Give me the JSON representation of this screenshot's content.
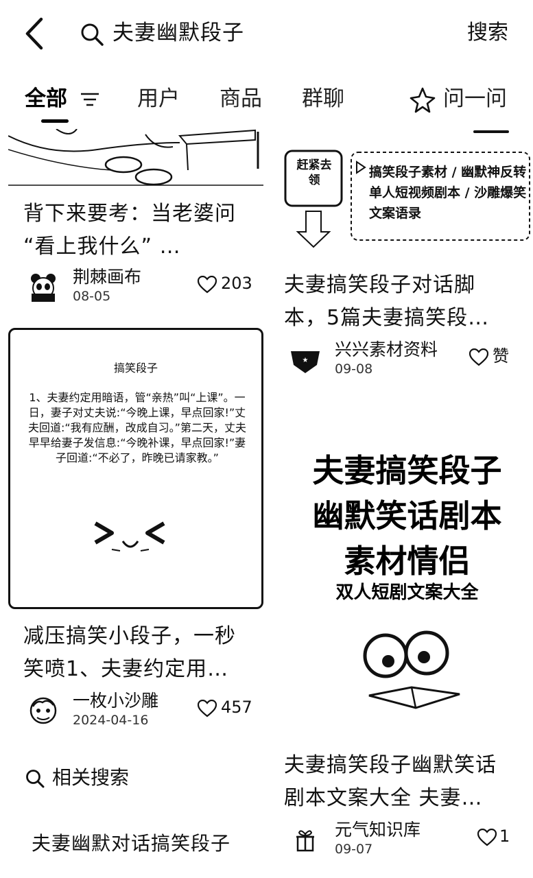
{
  "search": {
    "query": "夫妻幽默段子",
    "button_label": "搜索"
  },
  "tabs": [
    {
      "label": "全部"
    },
    {
      "label": "用户"
    },
    {
      "label": "商品"
    },
    {
      "label": "群聊"
    },
    {
      "label": "问一问"
    }
  ],
  "left_column": [
    {
      "title": "背下来要考：当老婆问 “看上我什么” …",
      "author": "荆棘画布",
      "date": "08-05",
      "likes": "203"
    },
    {
      "thumb": {
        "heading": "搞笑段子",
        "body": "1、夫妻约定用暗语，管“亲热”叫“上课”。一日，妻子对丈夫说:“今晚上课，早点回家!”丈夫回道:“我有应酬，改成自习。”第二天，丈夫早早给妻子发信息:“今晚补课，早点回家!”妻子回道:“不必了，昨晚已请家教。”"
      },
      "title": "减压搞笑小段子，一秒笑喷1、夫妻约定用…",
      "author": "一枚小沙雕",
      "date": "2024-04-16",
      "likes": "457"
    }
  ],
  "right_column": [
    {
      "thumb": {
        "badge": "赶紧去领",
        "text": "搞笑段子素材 / 幽默神反转 单人短视频剧本 / 沙雕爆笑文案语录"
      },
      "title": "夫妻搞笑段子对话脚本，5篇夫妻搞笑段…",
      "author": "兴兴素材资料",
      "date": "09-08",
      "likes": "赞"
    },
    {
      "thumb": {
        "line1": "夫妻搞笑段子",
        "line2": "幽默笑话剧本",
        "line3": "素材情侣",
        "line4": "双人短剧文案大全"
      },
      "title": "夫妻搞笑段子幽默笑话剧本文案大全 夫妻…",
      "author": "元气知识库",
      "date": "09-07",
      "likes": "1"
    }
  ],
  "related": {
    "heading": "相关搜索",
    "items": [
      "夫妻幽默对话搞笑段子"
    ]
  },
  "icons": [
    "back-icon",
    "search-icon",
    "filter-icon",
    "sparkle-icon",
    "heart-icon"
  ]
}
